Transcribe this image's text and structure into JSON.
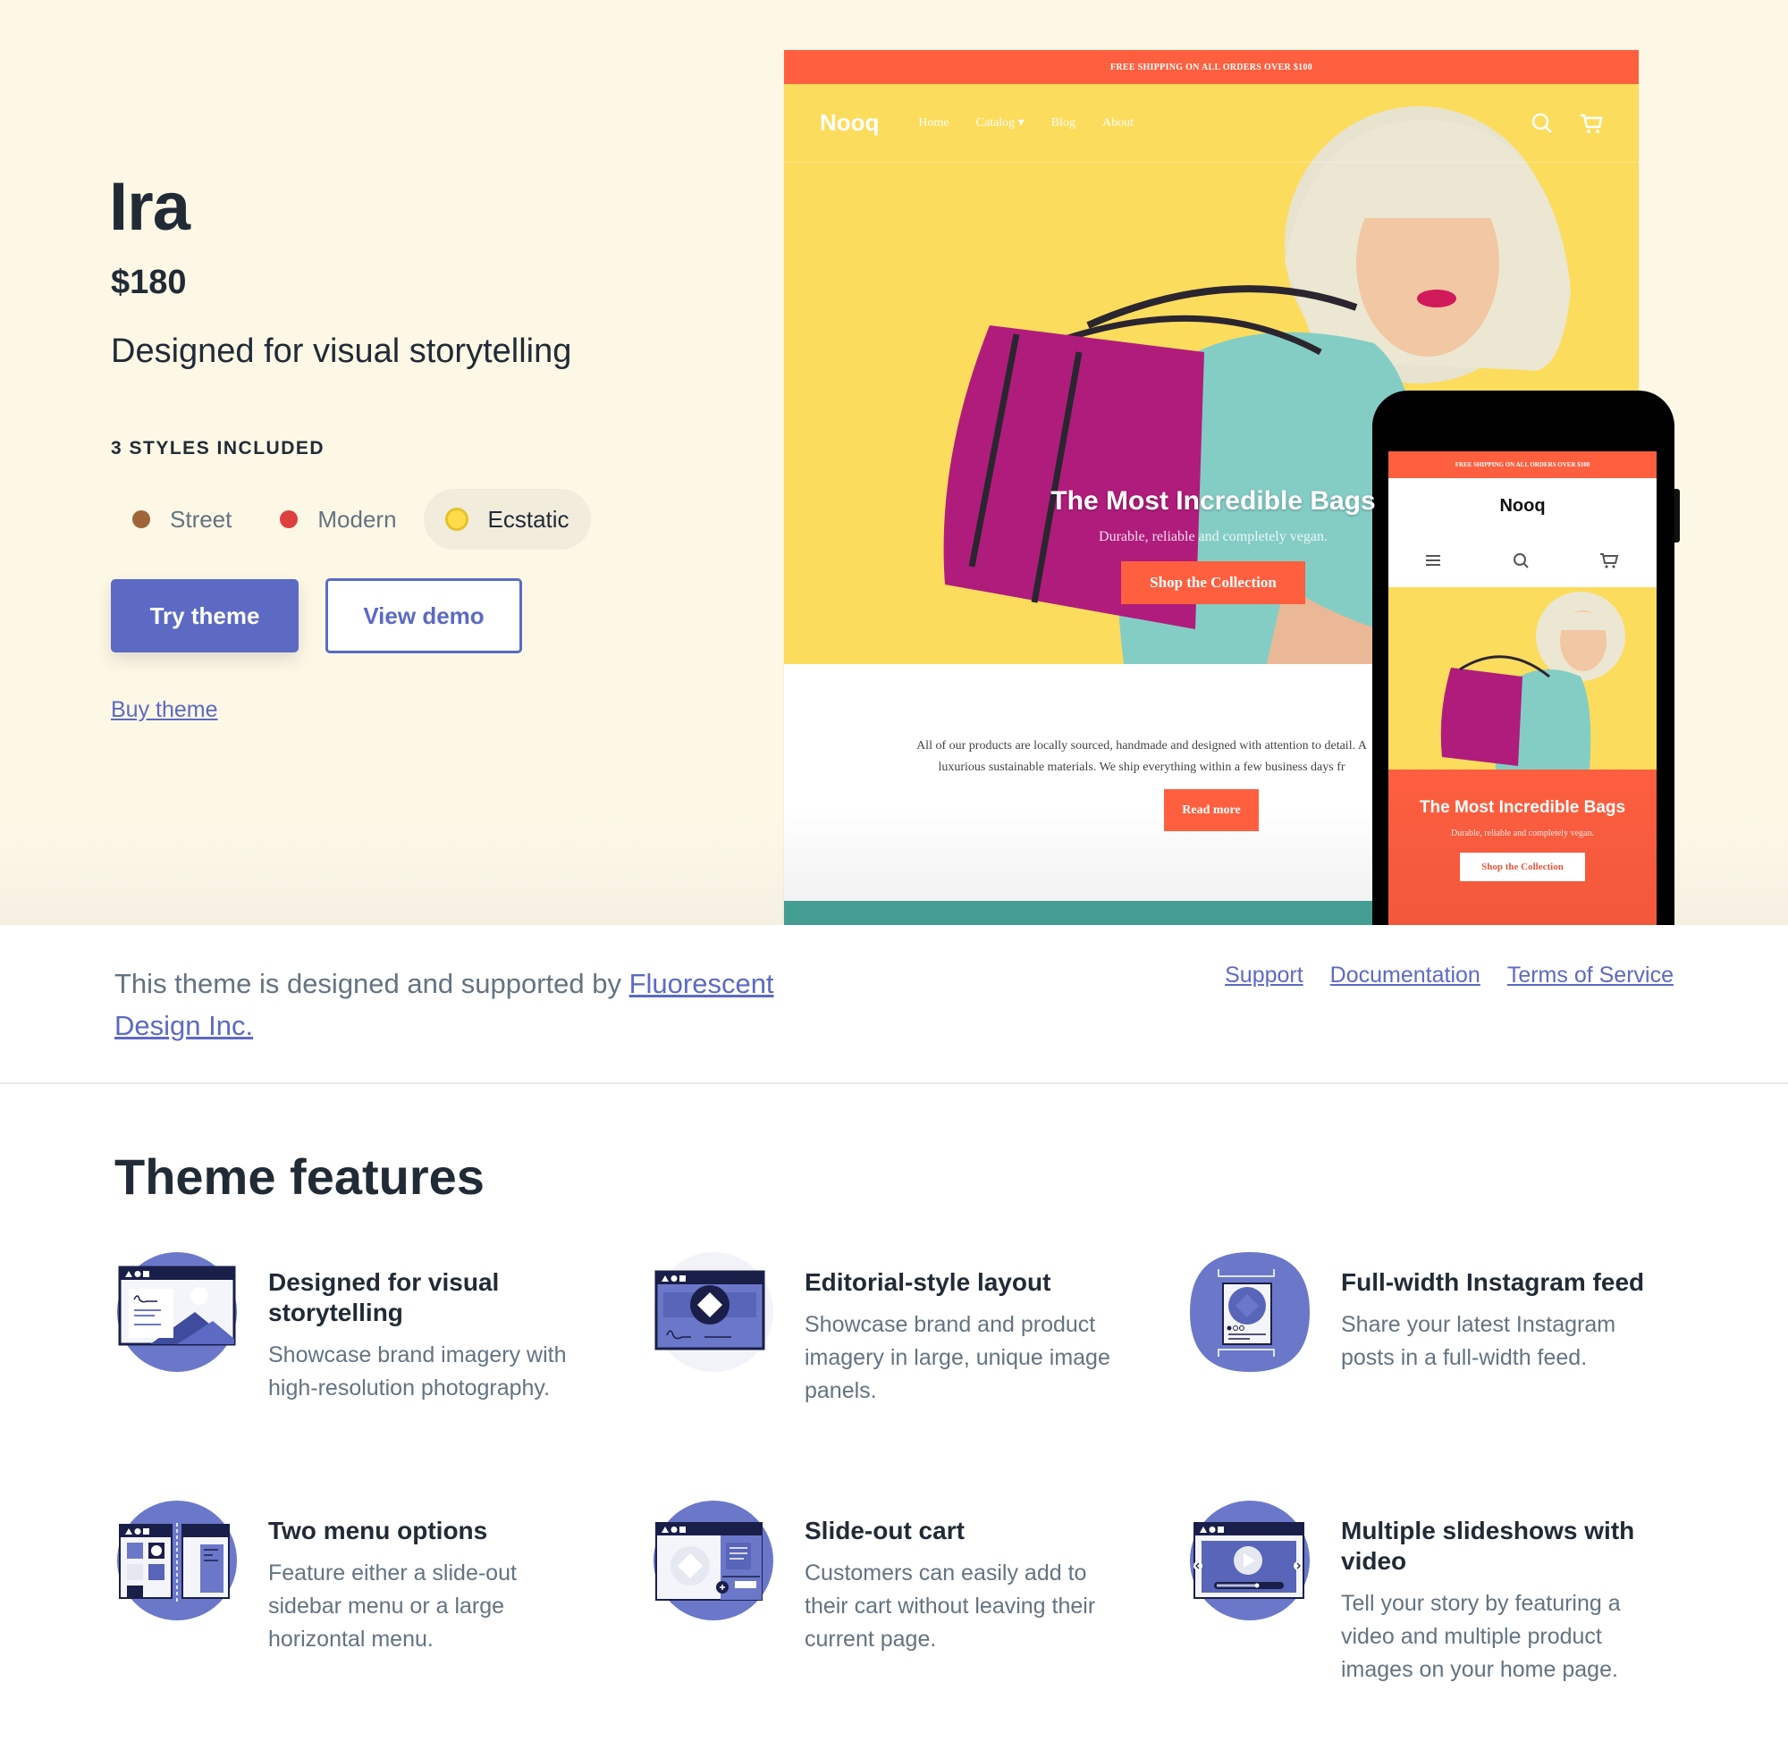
{
  "hero": {
    "title": "Ira",
    "price": "$180",
    "tagline": "Designed for visual storytelling",
    "styles_label": "3 STYLES INCLUDED",
    "styles": [
      {
        "name": "Street",
        "color": "#a0643a",
        "selected": false
      },
      {
        "name": "Modern",
        "color": "#de3f3f",
        "selected": false
      },
      {
        "name": "Ecstatic",
        "color": "#fcdc4a",
        "selected": true
      }
    ],
    "try_button": "Try theme",
    "demo_button": "View demo",
    "buy_link": "Buy theme"
  },
  "desktop_preview": {
    "announcement": "FREE SHIPPING ON ALL ORDERS OVER $100",
    "logo": "Nooq",
    "nav": [
      "Home",
      "Catalog ▾",
      "Blog",
      "About"
    ],
    "hero_title": "The Most Incredible Bags",
    "hero_subtitle": "Durable, reliable and completely vegan.",
    "hero_button": "Shop the Collection",
    "body_line1": "All of our products are locally sourced, handmade and designed with attention to detail. A",
    "body_line2": "luxurious sustainable materials. We ship everything within a few business days fr",
    "read_more": "Read more"
  },
  "mobile_preview": {
    "announcement": "FREE SHIPPING ON ALL ORDERS OVER $100",
    "logo": "Nooq",
    "hero_title": "The Most Incredible Bags",
    "hero_subtitle": "Durable, reliable and completely vegan.",
    "hero_button": "Shop the Collection"
  },
  "credit": {
    "text": "This theme is designed and supported by ",
    "designer_link": "Fluorescent Design Inc.",
    "links": [
      "Support",
      "Documentation",
      "Terms of Service"
    ]
  },
  "features": {
    "title": "Theme features",
    "items": [
      {
        "title": "Designed for visual storytelling",
        "description": "Showcase brand imagery with high-resolution photography."
      },
      {
        "title": "Editorial-style layout",
        "description": "Showcase brand and product imagery in large, unique image panels."
      },
      {
        "title": "Full-width Instagram feed",
        "description": "Share your latest Instagram posts in a full-width feed."
      },
      {
        "title": "Two menu options",
        "description": "Feature either a slide-out sidebar menu or a large horizontal menu."
      },
      {
        "title": "Slide-out cart",
        "description": "Customers can easily add to their cart without leaving their current page."
      },
      {
        "title": "Multiple slideshows with video",
        "description": "Tell your story by featuring a video and multiple product images on your home page."
      }
    ]
  },
  "colors": {
    "accent": "#5c6ac4",
    "hero_bg": "#fdf8e6",
    "preview_orange": "#fd5f3f",
    "preview_yellow": "#fcdc5d",
    "preview_teal": "#449d93"
  }
}
